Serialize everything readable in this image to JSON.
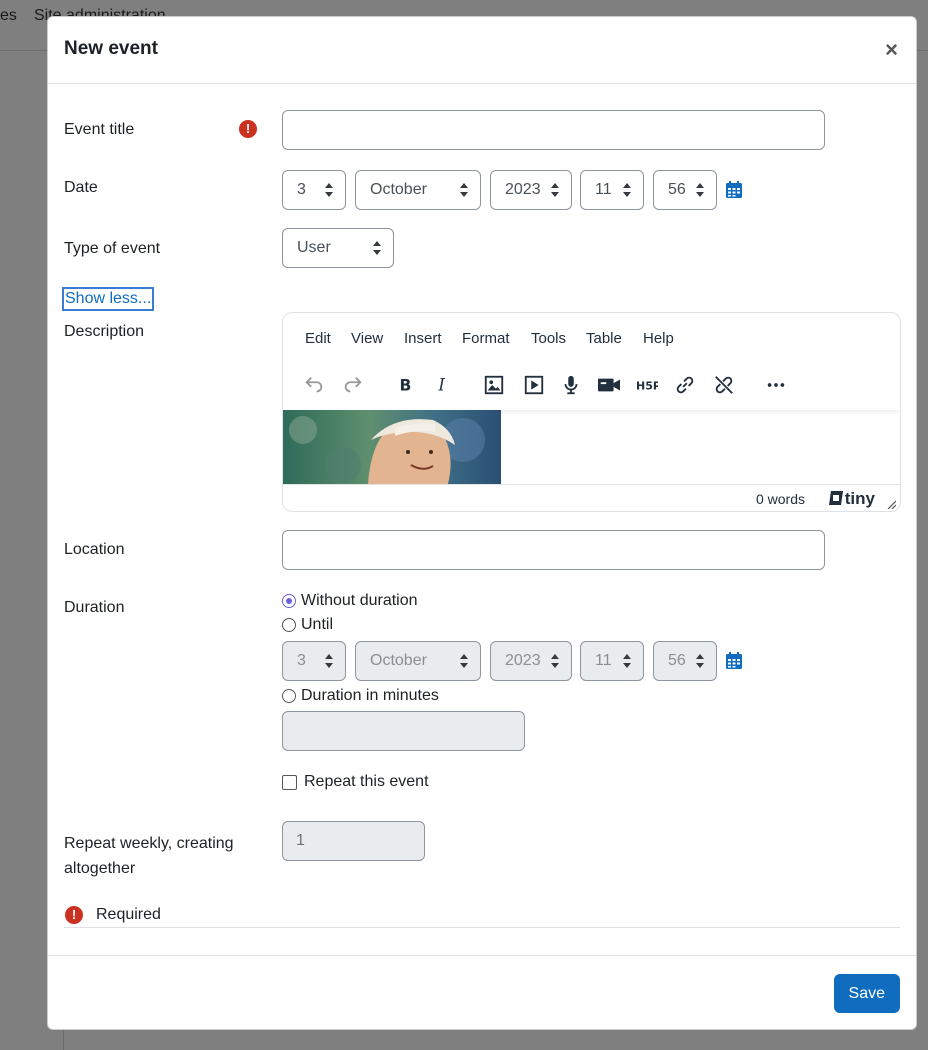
{
  "background": {
    "nav_items": [
      "es",
      "Site administration"
    ]
  },
  "modal": {
    "title": "New event",
    "close_label": "×",
    "save_label": "Save"
  },
  "form": {
    "event_title": {
      "label": "Event title",
      "value": "",
      "required": true
    },
    "date": {
      "label": "Date",
      "day": "3",
      "month": "October",
      "year": "2023",
      "hour": "11",
      "minute": "56"
    },
    "type_of_event": {
      "label": "Type of event",
      "value": "User"
    },
    "show_less": "Show less...",
    "description": {
      "label": "Description",
      "menu": [
        "Edit",
        "View",
        "Insert",
        "Format",
        "Tools",
        "Table",
        "Help"
      ],
      "toolbar": [
        "undo-icon",
        "redo-icon",
        "bold-icon",
        "italic-icon",
        "image-icon",
        "media-icon",
        "record-audio-icon",
        "record-video-icon",
        "h5p-icon",
        "link-icon",
        "unlink-icon",
        "more-icon"
      ],
      "word_count": "0 words",
      "brand": "tiny"
    },
    "location": {
      "label": "Location",
      "value": ""
    },
    "duration": {
      "label": "Duration",
      "options": [
        "Without duration",
        "Until",
        "Duration in minutes"
      ],
      "selected": "Without duration",
      "until": {
        "day": "3",
        "month": "October",
        "year": "2023",
        "hour": "11",
        "minute": "56"
      },
      "minutes_value": ""
    },
    "repeat": {
      "label": "Repeat this event",
      "checked": false
    },
    "repeat_weekly": {
      "label": "Repeat weekly, creating altogether",
      "value": "1"
    },
    "required_note": "Required"
  },
  "colors": {
    "primary": "#0f6cbf",
    "required": "#ca3120",
    "radio": "#6c63d9"
  }
}
